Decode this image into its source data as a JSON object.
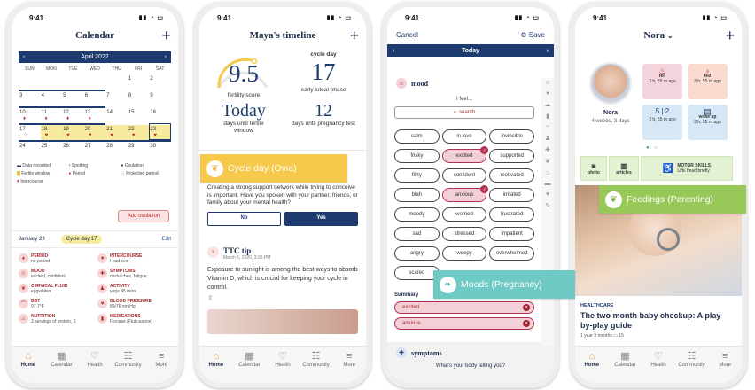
{
  "status_time": "9:41",
  "nav": [
    "Home",
    "Calendar",
    "Health",
    "Community",
    "More"
  ],
  "calendar": {
    "title": "Calendar",
    "month": "April 2022",
    "dows": [
      "SUN",
      "MON",
      "TUE",
      "WED",
      "THU",
      "FRI",
      "SAT"
    ],
    "days": [
      "",
      "",
      "",
      "",
      "",
      "1",
      "2",
      "3",
      "4",
      "5",
      "6",
      "7",
      "8",
      "9",
      "10",
      "11",
      "12",
      "13",
      "14",
      "15",
      "16",
      "17",
      "18",
      "19",
      "20",
      "21",
      "22",
      "23",
      "24",
      "25",
      "26",
      "27",
      "28",
      "29",
      "30"
    ],
    "legend": [
      "Data recorded",
      "Spotting",
      "Ovulation",
      "Fertile window",
      "Period",
      "Projected period",
      "Intercourse"
    ],
    "add_ovulation": "Add ovulation",
    "log_date": "January 23",
    "cycle_day_pill": "Cycle day 17",
    "edit": "Edit",
    "symptoms": [
      {
        "t": "PERIOD",
        "s": "no period"
      },
      {
        "t": "INTERCOURSE",
        "s": "I had sex"
      },
      {
        "t": "MOOD",
        "s": "excited, confident"
      },
      {
        "t": "SYMPTOMS",
        "s": "neckaches, fatigue"
      },
      {
        "t": "CERVICAL FLUID",
        "s": "eggwhites"
      },
      {
        "t": "ACTIVITY",
        "s": "yoga 45 mins"
      },
      {
        "t": "BBT",
        "s": "97.7°F"
      },
      {
        "t": "BLOOD PRESSURE",
        "s": "89/76 mmHg"
      },
      {
        "t": "NUTRITION",
        "s": "3 servings of protein, 3"
      },
      {
        "t": "MEDICATIONS",
        "s": "Flonase (Fluticasone)"
      }
    ]
  },
  "timeline": {
    "title": "Maya's timeline",
    "fertility_score": "9.5",
    "fertility_label": "fertility score",
    "cycle_day_label": "cycle day",
    "cycle_day": "17",
    "phase": "early luteal phase",
    "today": "Today",
    "today_label": "days until fertile window",
    "days_to_test": "12",
    "test_label": "days until pregnancy test",
    "question": "Creating a strong support network while trying to conceive is important. Have you spoken with your partner, friends, or family about your mental health?",
    "no": "No",
    "yes": "Yes",
    "tip_title": "TTC tip",
    "tip_date": "March 5, 2020, 3:36 PM",
    "tip_body": "Exposure to sunlight is among the best ways to absorb Vitamin D, which is crucial for keeping your cycle in control."
  },
  "moods": {
    "cancel": "Cancel",
    "save": "Save",
    "date": "Today",
    "section": "mood",
    "prompt": "I feel...",
    "search": "search",
    "pills": [
      "calm",
      "in love",
      "invincible",
      "frisky",
      "excited",
      "supported",
      "flirty",
      "confident",
      "motivated",
      "blah",
      "anxious",
      "irritated",
      "moody",
      "worried",
      "frustrated",
      "sad",
      "stressed",
      "impatient",
      "angry",
      "weepy",
      "overwhelmed",
      "scared"
    ],
    "selected": [
      "excited",
      "anxious"
    ],
    "summary_label": "Summary",
    "summary": [
      "excited",
      "anxious"
    ],
    "next_section": "symptoms",
    "next_prompt": "What's your body telling you?"
  },
  "nora": {
    "name": "Nora",
    "header_name": "Nora",
    "age": "4 weeks, 3 days",
    "tiles": [
      {
        "t": "fed",
        "s": "3 h, 55 m ago"
      },
      {
        "t": "fed",
        "s": "3 h, 55 m ago"
      },
      {
        "t": "5 | 2",
        "s": "3 h, 55 m ago"
      },
      {
        "t": "woke up",
        "s": "3 h, 55 m ago"
      }
    ],
    "photo": "photo",
    "articles": "articles",
    "motor_title": "MOTOR SKILLS",
    "motor_sub": "Lifts head briefly",
    "kicker": "HEALTHCARE",
    "headline": "The two month baby checkup: A play-by-play guide",
    "meta": "1 year 9 months",
    "comments": "15"
  },
  "badges": {
    "cycle": "Cycle day (Ovia)",
    "moods": "Moods (Pregnancy)",
    "feedings": "Feedings (Parenting)"
  },
  "colors": {
    "navy": "#1d3b6e",
    "yellow": "#f6c84c",
    "teal": "#6fc9c4",
    "green": "#98c858",
    "rose": "#c0282d"
  }
}
